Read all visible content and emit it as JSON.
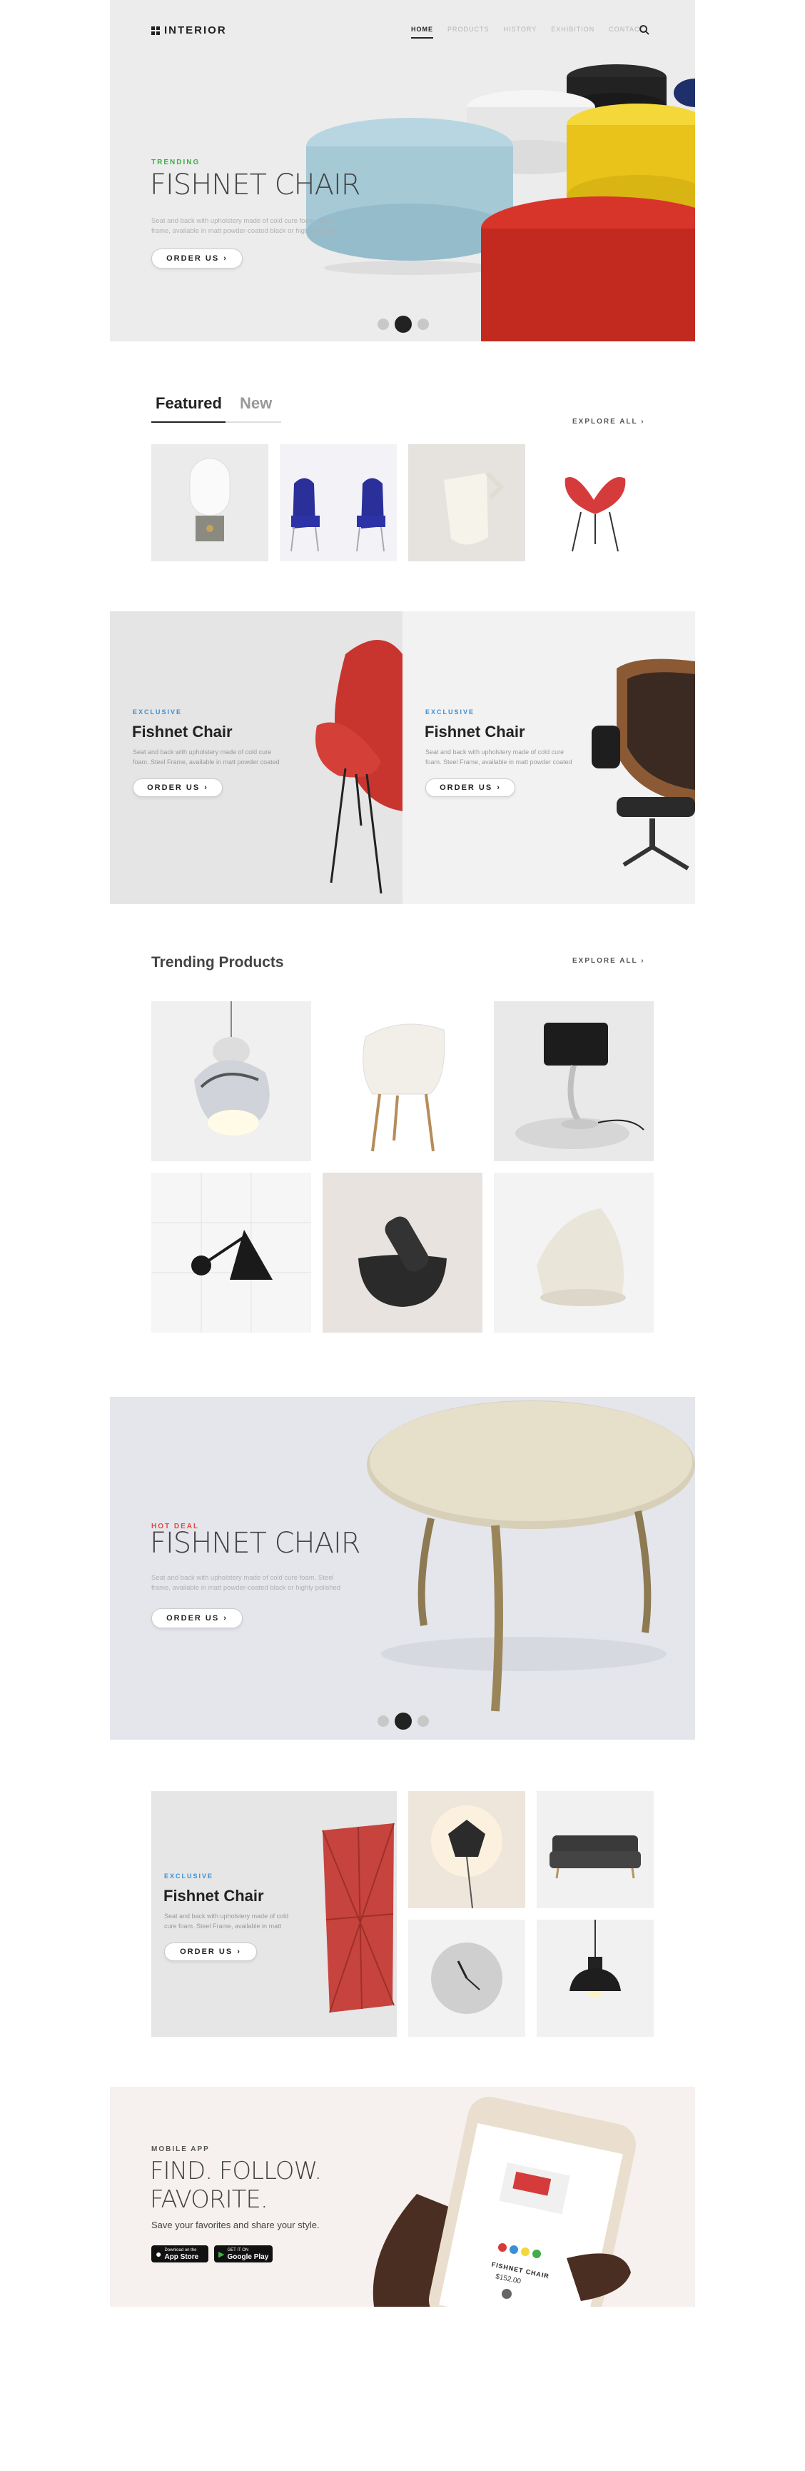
{
  "header": {
    "logo": "INTERIOR",
    "nav": [
      "HOME",
      "PRODUCTS",
      "HISTORY",
      "EXHIBITION",
      "CONTACT"
    ]
  },
  "hero": {
    "eyebrow": "TRENDING",
    "title": "FISHNET CHAIR",
    "desc_line1": "Seat and back with upholstery made of cold cure foam. Steel",
    "desc_line2": "frame, available in matt powder-coated black or highly polished",
    "button": "ORDER US"
  },
  "featured": {
    "tab_active": "Featured",
    "tab_inactive": "New",
    "explore": "EXPLORE ALL"
  },
  "exclusive_left": {
    "eyebrow": "EXCLUSIVE",
    "title": "Fishnet Chair",
    "desc_line1": "Seat and back with upholstery made of cold cure",
    "desc_line2": "foam. Steel Frame, available in matt powder coated",
    "button": "ORDER US"
  },
  "exclusive_right": {
    "eyebrow": "EXCLUSIVE",
    "title": "Fishnet Chair",
    "desc_line1": "Seat and back with upholstery made of cold cure",
    "desc_line2": "foam. Steel Frame, available in matt powder coated",
    "button": "ORDER US"
  },
  "trending": {
    "title": "Trending Products",
    "explore": "EXPLORE ALL"
  },
  "hot_deal": {
    "eyebrow": "HOT DEAL",
    "title": "FISHNET CHAIR",
    "desc_line1": "Seat and back with upholstery made of cold cure foam. Steel",
    "desc_line2": "frame, available in matt powder-coated black or highly polished",
    "button": "ORDER US"
  },
  "exclusive_bottom": {
    "eyebrow": "EXCLUSIVE",
    "title": "Fishnet Chair",
    "desc_line1": "Seat and back with upholstery made of cold",
    "desc_line2": "cure foam. Steel Frame, available in matt",
    "button": "ORDER US"
  },
  "app": {
    "eyebrow": "MOBILE APP",
    "title_line1": "FIND. FOLLOW.",
    "title_line2": "FAVORITE.",
    "subtitle": "Save your favorites and share your style.",
    "appstore_small": "Download on the",
    "appstore": "App Store",
    "googleplay_small": "GET IT ON",
    "googleplay": "Google Play",
    "phone_product": "FISHNET CHAIR",
    "phone_price": "$152.00"
  },
  "colors": {
    "trending": "#3fae49",
    "exclusive": "#3a8fd6",
    "hot_deal": "#e24a3b",
    "hero_bg": "#ececec"
  },
  "icons": [
    "search-icon",
    "chevron-right-icon",
    "apple-icon",
    "google-play-icon"
  ]
}
